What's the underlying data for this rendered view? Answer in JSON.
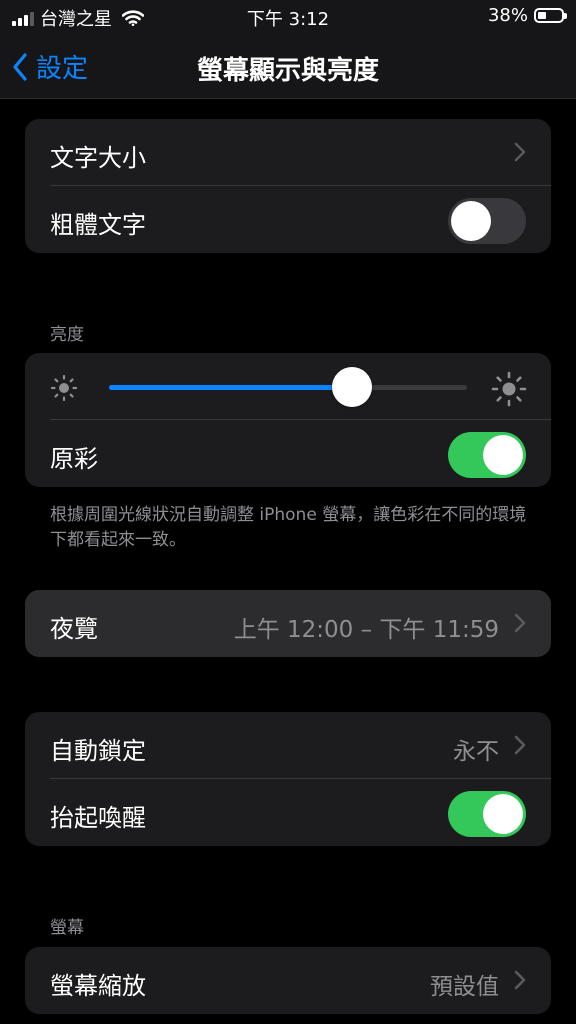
{
  "status_bar": {
    "carrier": "台灣之星",
    "time": "下午 3:12",
    "battery_percent": "38%",
    "battery_level": 0.38,
    "icons": [
      "signal-icon",
      "wifi-icon",
      "battery-icon"
    ]
  },
  "nav": {
    "back_label": "設定",
    "title": "螢幕顯示與亮度",
    "accent_color": "#0a84ff"
  },
  "text_group": {
    "text_size_label": "文字大小",
    "bold_text_label": "粗體文字",
    "bold_text_on": false
  },
  "brightness": {
    "header": "亮度",
    "level": 0.68,
    "true_tone_label": "原彩",
    "true_tone_on": true,
    "note": "根據周圍光線狀況自動調整 iPhone 螢幕，讓色彩在不同的環境下都看起來一致。"
  },
  "night_shift": {
    "label": "夜覽",
    "value": "上午 12:00 – 下午 11:59"
  },
  "lock_group": {
    "auto_lock_label": "自動鎖定",
    "auto_lock_value": "永不",
    "raise_to_wake_label": "抬起喚醒",
    "raise_to_wake_on": true
  },
  "display": {
    "header": "螢幕",
    "zoom_label": "螢幕縮放",
    "zoom_value": "預設值"
  },
  "colors": {
    "toggle_on": "#34c759",
    "toggle_off": "#39393d",
    "group_bg": "#1c1c1e",
    "secondary_text": "#8e8e93"
  }
}
